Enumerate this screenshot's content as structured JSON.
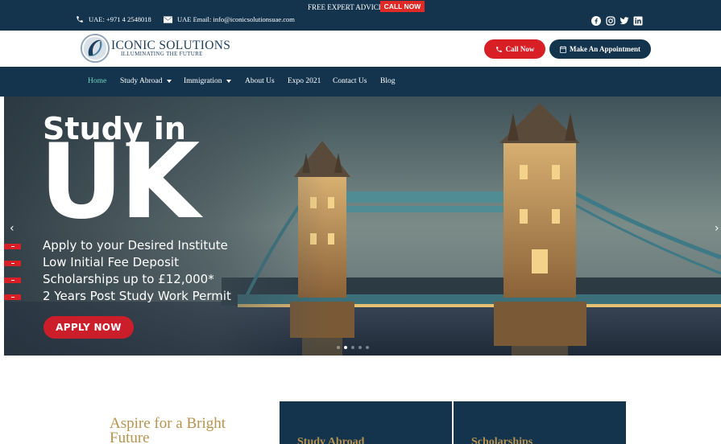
{
  "topbar": {
    "promo_text": "FREE EXPERT ADVICE",
    "promo_button": "CALL NOW",
    "phone": "UAE: +971 4 2548018",
    "email": "UAE Email: info@iconicsolutionsuae.com",
    "social_icons": [
      "facebook-icon",
      "instagram-icon",
      "twitter-icon",
      "linkedin-icon"
    ]
  },
  "header": {
    "logo_title": "ICONIC SOLUTIONS",
    "logo_tagline": "ILLUMINATING THE FUTURE",
    "call_button": "Call Now",
    "appointment_button": "Make An Appointment"
  },
  "nav": {
    "items": [
      {
        "label": "Home",
        "active": true
      },
      {
        "label": "Study Abroad",
        "dropdown": true
      },
      {
        "label": "Immigration",
        "dropdown": true
      },
      {
        "label": "About Us"
      },
      {
        "label": "Expo 2021"
      },
      {
        "label": "Contact Us"
      },
      {
        "label": "Blog"
      }
    ]
  },
  "hero": {
    "title_line1": "Study in",
    "title_line2": "UK",
    "bullets": [
      "Apply to your Desired Institute",
      "Low Initial Fee Deposit",
      "Scholarships up to £12,000*",
      "2 Years Post Study Work Permit"
    ],
    "apply_button": "APPLY NOW",
    "prev_arrow": "‹",
    "next_arrow": "›",
    "slide_count": 5,
    "active_slide": 2
  },
  "intro": {
    "heading": "Aspire for a Bright Future"
  },
  "cards": [
    {
      "title": "Study Abroad"
    },
    {
      "title": "Scholarships"
    }
  ],
  "colors": {
    "navy": "#14344e",
    "red": "#d81f26",
    "gold": "#b79350",
    "active_nav": "#6fd3b8"
  }
}
